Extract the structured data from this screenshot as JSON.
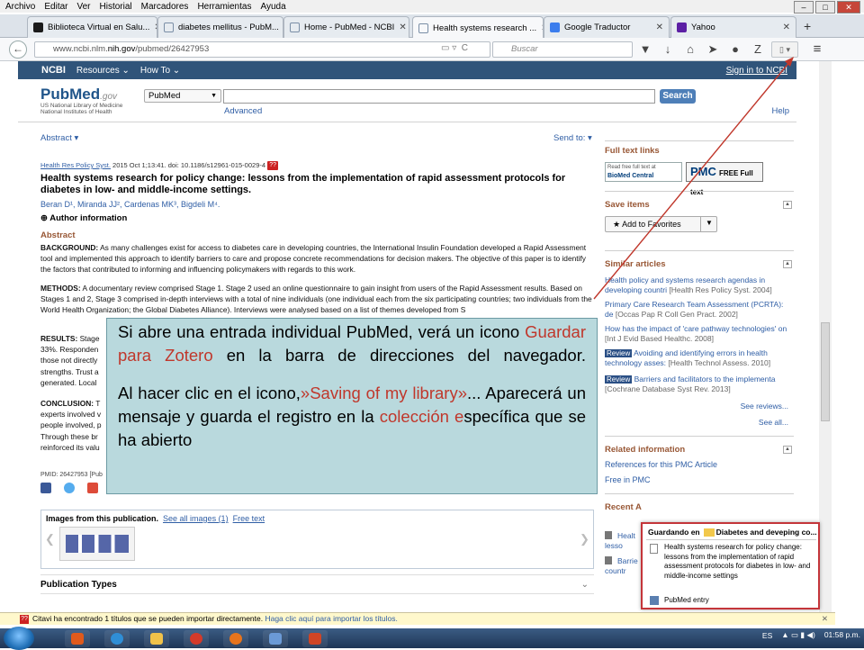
{
  "menubar": [
    "Archivo",
    "Editar",
    "Ver",
    "Historial",
    "Marcadores",
    "Herramientas",
    "Ayuda"
  ],
  "tabs": [
    {
      "title": "Biblioteca Virtual en Salu...",
      "color": "#1b1b1b"
    },
    {
      "title": "diabetes mellitus - PubM...",
      "color": "#7a8ea6"
    },
    {
      "title": "Home - PubMed - NCBI",
      "color": "#7a8ea6"
    },
    {
      "title": "Health systems research ...",
      "color": "#7a8ea6"
    },
    {
      "title": "Google Traductor",
      "color": "#3b7ded"
    },
    {
      "title": "Yahoo",
      "color": "#5c1fa4"
    }
  ],
  "navbar": {
    "url_prefix": "www.ncbi.nlm.",
    "url_host": "nih.gov",
    "url_path": "/pubmed/26427953",
    "search_placeholder": "Buscar",
    "zotero_label": "Z"
  },
  "ncbi": {
    "logo": "NCBI",
    "resources": "Resources ⌄",
    "howto": "How To ⌄",
    "signin": "Sign in to NCBI"
  },
  "pubmed": {
    "logo": "PubMed",
    "logo_gov": ".gov",
    "sub1": "US National Library of Medicine",
    "sub2": "National Institutes of Health",
    "db": "PubMed",
    "search_btn": "Search",
    "advanced": "Advanced",
    "help": "Help"
  },
  "article": {
    "view": "Abstract ▾",
    "sendto": "Send to: ▾",
    "journal": "Health Res Policy Syst.",
    "citation": " 2015 Oct 1;13:41. doi: 10.1186/s12961-015-0029-4 ",
    "title": "Health systems research for policy change: lessons from the implementation of rapid assessment protocols for diabetes in low- and middle-income settings.",
    "authors": "Beran D¹, Miranda JJ², Cardenas MK³, Bigdeli M⁴.",
    "author_info": "⊕ Author information",
    "abstract_heading": "Abstract",
    "background_lbl": "BACKGROUND:",
    "background": " As many challenges exist for access to diabetes care in developing countries, the International Insulin Foundation developed a Rapid Assessment tool and implemented this approach to identify barriers to care and propose concrete recommendations for decision makers. The objective of this paper is to identify the factors that contributed to informing and influencing policymakers with regards to this work.",
    "methods_lbl": "METHODS:",
    "methods": " A documentary review comprised Stage 1. Stage 2 used an online questionnaire to gain insight from users of the Rapid Assessment results. Based on Stages 1 and 2, Stage 3 comprised in-depth interviews with a total of nine individuals (one individual each from the six participating countries; two individuals from the World Health Organization; the Global Diabetes Alliance). Interviews were analysed based on a list of themes developed from S",
    "results_lbl": "RESULTS:",
    "results": " Stage\n33%. Responden\nthose not directly\nstrengths. Trust a\ngenerated. Local",
    "conclusion_lbl": "CONCLUSION:",
    "conclusion": " T\nexperts involved v\npeople involved, p\nThrough these br\nreinforced its valu",
    "pmid": "PMID: 26427953 [Pub",
    "images_title": "Images from this publication.",
    "images_all": "See all images (1)",
    "images_free": "Free text",
    "pubtypes": "Publication Types"
  },
  "sidebar": {
    "fulltext_h": "Full text links",
    "biomed_small": "Read free full text at",
    "biomed": "BioMed Central",
    "pmc": "PMC",
    "pmc_sub": "FREE Full text",
    "save_h": "Save items",
    "add_fav": "★ Add to Favorites",
    "similar_h": "Similar articles",
    "similar": [
      {
        "t": "Health policy and systems research agendas in developing countri",
        "j": "[Health Res Policy Syst. 2004]",
        "review": false
      },
      {
        "t": "Primary Care Research Team Assessment (PCRTA): de",
        "j": "[Occas Pap R Coll Gen Pract. 2002]",
        "review": false
      },
      {
        "t": "How has the impact of 'care pathway technologies' on",
        "j": "[Int J Evid Based Healthc. 2008]",
        "review": false
      },
      {
        "t": "Avoiding and identifying errors in health technology asses:",
        "j": "[Health Technol Assess. 2010]",
        "review": true
      },
      {
        "t": "Barriers and facilitators to the implementa",
        "j": "[Cochrane Database Syst Rev. 2013]",
        "review": true
      }
    ],
    "see_reviews": "See reviews...",
    "see_all": "See all...",
    "related_h": "Related information",
    "related1": "References for this PMC Article",
    "related2": "Free in PMC",
    "recent_h": "Recent A",
    "recent": [
      "Healt\nlesso",
      "Barrie\ncountr"
    ]
  },
  "callout": {
    "p1a": "Si abre una entrada individual PubMed, verá un icono ",
    "p1red": "Guardar para Zotero",
    "p1b": " en la barra de direcciones del navegador.",
    "p2a": "Al hacer clic en el icono,",
    "p2red": "»Saving of my library»",
    "p2b": "... Aparecerá un mensaje y guarda el registro en la ",
    "p2red2": "colección e",
    "p2c": "specífica que se ha abierto"
  },
  "zotero": {
    "saving": "Guardando en",
    "collection": "Diabetes and deveping co...",
    "item": "Health systems research for policy change: lessons from the implementation of rapid assessment protocols for diabetes in low- and middle-income settings",
    "entry": "PubMed entry"
  },
  "notification": {
    "text": "Citavi ha encontrado 1 títulos que se pueden importar directamente. ",
    "link": "Haga clic aquí para importar los títulos."
  },
  "taskbar": {
    "lang": "ES",
    "time": "01:58 p.m."
  },
  "colors": {
    "ncbi_bar": "#30547a",
    "link": "#2f5ea5",
    "heading": "#985735",
    "callout_bg": "#b9d9dd",
    "accent_red": "#c0372b"
  }
}
